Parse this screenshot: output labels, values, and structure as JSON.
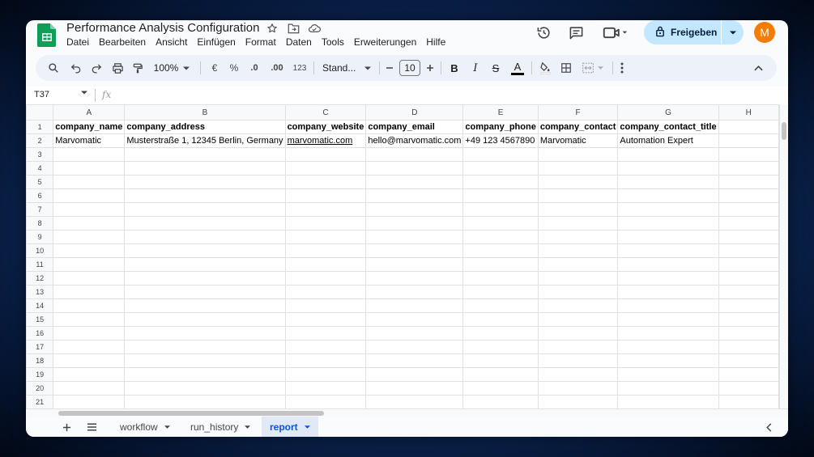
{
  "app": {
    "title": "Performance Analysis Configuration",
    "menu": [
      "Datei",
      "Bearbeiten",
      "Ansicht",
      "Einfügen",
      "Format",
      "Daten",
      "Tools",
      "Erweiterungen",
      "Hilfe"
    ],
    "share_label": "Freigeben",
    "avatar_letter": "M",
    "accent": "#c2e7ff",
    "avatar_color": "#f57c00"
  },
  "toolbar": {
    "zoom": "100%",
    "currency": "€",
    "percent": "%",
    "decimal_less": ".0",
    "decimal_more": ".00",
    "number_format": "123",
    "font": "Stand...",
    "font_size": "10",
    "bold": "B",
    "italic": "I",
    "strike": "S",
    "text_color": "A"
  },
  "formula_bar": {
    "cell_ref": "T37",
    "fx": "fx"
  },
  "sheet": {
    "columns": [
      "A",
      "B",
      "C",
      "D",
      "E",
      "F",
      "G",
      "H"
    ],
    "rows": [
      [
        "company_name",
        "company_address",
        "company_website",
        "company_email",
        "company_phone",
        "company_contact",
        "company_contact_title",
        ""
      ],
      [
        "Marvomatic",
        "Musterstraße 1, 12345 Berlin, Germany",
        "marvomatic.com",
        "hello@marvomatic.com",
        "+49 123 4567890",
        "Marvomatic",
        "Automation Expert",
        ""
      ]
    ],
    "row_numbers": [
      "1",
      "2",
      "3",
      "4",
      "5",
      "6",
      "7",
      "8",
      "9",
      "10",
      "11",
      "12",
      "13",
      "14",
      "15",
      "16",
      "17",
      "18",
      "19",
      "20",
      "21"
    ]
  },
  "tabs": [
    {
      "label": "workflow",
      "active": false
    },
    {
      "label": "run_history",
      "active": false
    },
    {
      "label": "report",
      "active": true
    }
  ]
}
